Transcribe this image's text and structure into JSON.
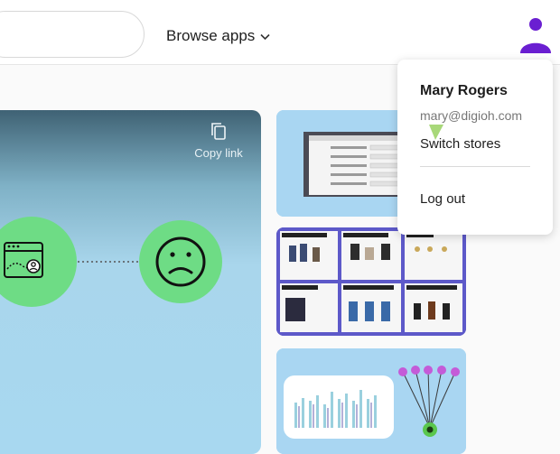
{
  "header": {
    "browse_label": "Browse apps",
    "chevron": "chevron-down-icon"
  },
  "hero": {
    "copy_link_label": "Copy link"
  },
  "account_menu": {
    "name": "Mary Rogers",
    "email": "mary@digioh.com",
    "switch_label": "Switch stores",
    "logout_label": "Log out"
  },
  "colors": {
    "accent_purple": "#6a1fd1",
    "green": "#6edc85",
    "light_blue": "#a8d8f0",
    "thumb_purple": "#5d59c9"
  }
}
